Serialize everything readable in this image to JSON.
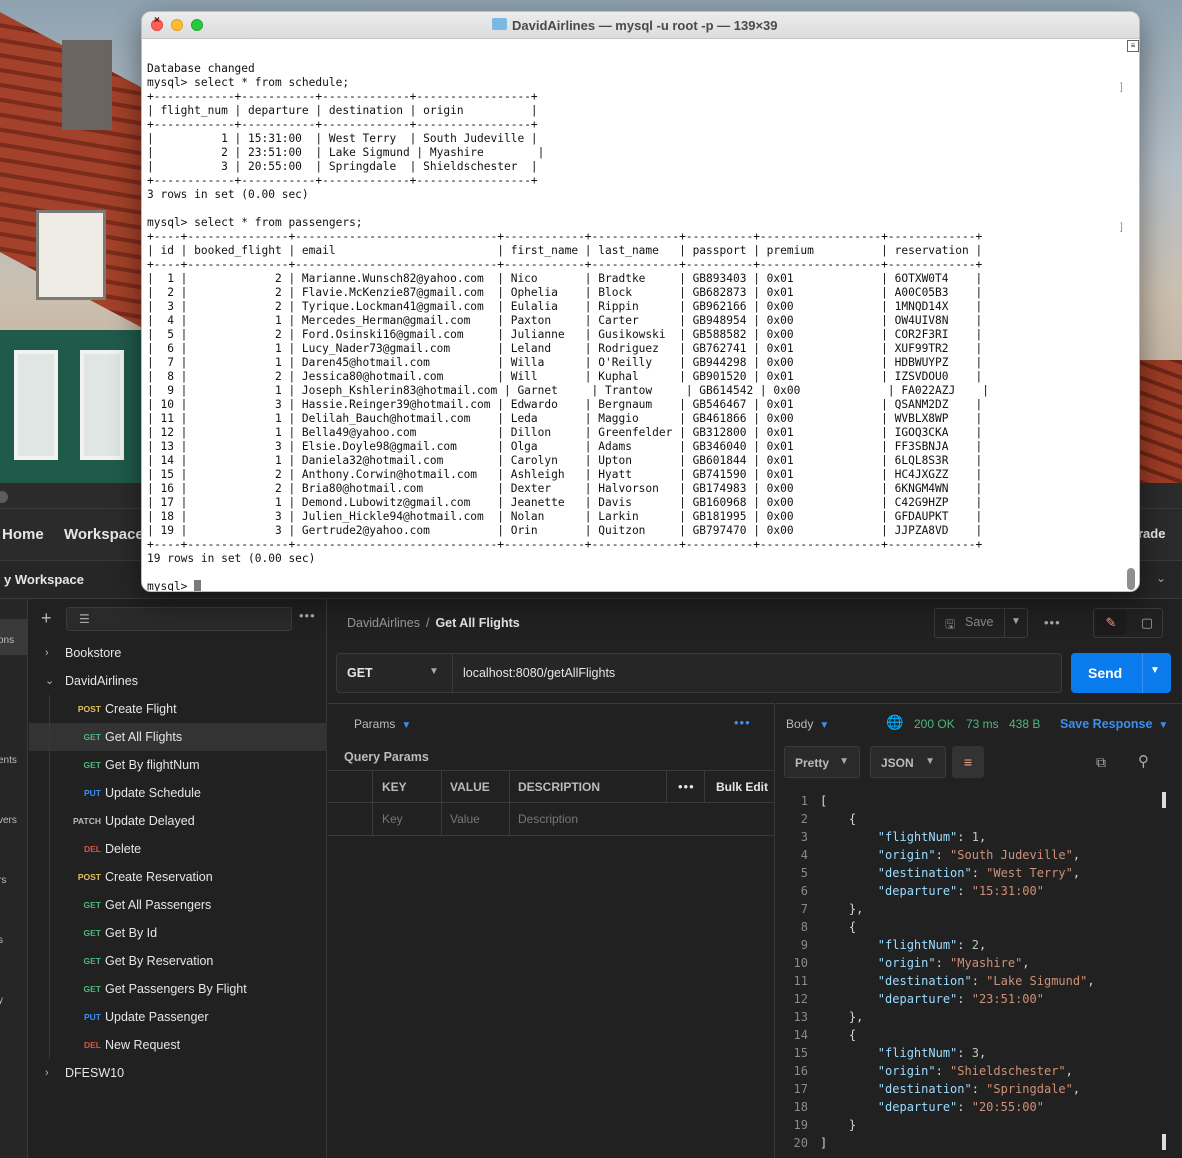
{
  "terminal": {
    "title": "DavidAirlines — mysql -u root -p — 139×39",
    "lines": [
      "Database changed",
      "mysql> select * from schedule;",
      "+------------+-----------+-------------+-----------------+",
      "| flight_num | departure | destination | origin          |",
      "+------------+-----------+-------------+-----------------+",
      "|          1 | 15:31:00  | West Terry  | South Judeville |",
      "|          2 | 23:51:00  | Lake Sigmund | Myashire        |",
      "|          3 | 20:55:00  | Springdale  | Shieldschester  |",
      "+------------+-----------+-------------+-----------------+",
      "3 rows in set (0.00 sec)",
      "",
      "mysql> select * from passengers;",
      "+----+---------------+------------------------------+------------+-------------+----------+------------------+-------------+",
      "| id | booked_flight | email                        | first_name | last_name   | passport | premium          | reservation |",
      "+----+---------------+------------------------------+------------+-------------+----------+------------------+-------------+",
      "|  1 |             2 | Marianne.Wunsch82@yahoo.com  | Nico       | Bradtke     | GB893403 | 0x01             | 6OTXW0T4    |",
      "|  2 |             2 | Flavie.McKenzie87@gmail.com  | Ophelia    | Block       | GB682873 | 0x01             | A00C05B3    |",
      "|  3 |             2 | Tyrique.Lockman41@gmail.com  | Eulalia    | Rippin      | GB962166 | 0x00             | 1MNQD14X    |",
      "|  4 |             1 | Mercedes_Herman@gmail.com    | Paxton     | Carter      | GB948954 | 0x00             | OW4UIV8N    |",
      "|  5 |             2 | Ford.Osinski16@gmail.com     | Julianne   | Gusikowski  | GB588582 | 0x00             | COR2F3RI    |",
      "|  6 |             1 | Lucy_Nader73@gmail.com       | Leland     | Rodriguez   | GB762741 | 0x01             | XUF99TR2    |",
      "|  7 |             1 | Daren45@hotmail.com          | Willa      | O'Reilly    | GB944298 | 0x00             | HDBWUYPZ    |",
      "|  8 |             2 | Jessica80@hotmail.com        | Will       | Kuphal      | GB901520 | 0x01             | IZSVDOU0    |",
      "|  9 |             1 | Joseph_Kshlerin83@hotmail.com | Garnet     | Trantow     | GB614542 | 0x00             | FA022AZJ    |",
      "| 10 |             3 | Hassie.Reinger39@hotmail.com | Edwardo    | Bergnaum    | GB546467 | 0x01             | QSANM2DZ    |",
      "| 11 |             1 | Delilah_Bauch@hotmail.com    | Leda       | Maggio      | GB461866 | 0x00             | WVBLX8WP    |",
      "| 12 |             1 | Bella49@yahoo.com            | Dillon     | Greenfelder | GB312800 | 0x01             | IGOQ3CKA    |",
      "| 13 |             3 | Elsie.Doyle98@gmail.com      | Olga       | Adams       | GB346040 | 0x01             | FF3SBNJA    |",
      "| 14 |             1 | Daniela32@hotmail.com        | Carolyn    | Upton       | GB601844 | 0x01             | 6LQL8S3R    |",
      "| 15 |             2 | Anthony.Corwin@hotmail.com   | Ashleigh   | Hyatt       | GB741590 | 0x01             | HC4JXGZZ    |",
      "| 16 |             2 | Bria80@hotmail.com           | Dexter     | Halvorson   | GB174983 | 0x00             | 6KNGM4WN    |",
      "| 17 |             1 | Demond.Lubowitz@gmail.com    | Jeanette   | Davis       | GB160968 | 0x00             | C42G9HZP    |",
      "| 18 |             3 | Julien_Hickle94@hotmail.com  | Nolan      | Larkin      | GB181995 | 0x00             | GFDAUPKT    |",
      "| 19 |             3 | Gertrude2@yahoo.com          | Orin       | Quitzon     | GB797470 | 0x00             | JJPZA8VD    |",
      "+----+---------------+------------------------------+------------+-------------+----------+------------------+-------------+",
      "19 rows in set (0.00 sec)",
      "",
      "mysql> "
    ]
  },
  "postman": {
    "nav": {
      "home": "Home",
      "workspaces": "Workspaces",
      "upgrade": "rade"
    },
    "workspace_name": "y Workspace",
    "rail": {
      "collections": "ons",
      "environments": "ents",
      "mock_servers": "vers",
      "monitors": "rs",
      "flows": "s",
      "history": "y"
    },
    "sidebar": {
      "collections": [
        {
          "name": "Bookstore",
          "expanded": false,
          "requests": []
        },
        {
          "name": "DavidAirlines",
          "expanded": true,
          "requests": [
            {
              "method": "POST",
              "name": "Create Flight",
              "active": false
            },
            {
              "method": "GET",
              "name": "Get All Flights",
              "active": true
            },
            {
              "method": "GET",
              "name": "Get By flightNum",
              "active": false
            },
            {
              "method": "PUT",
              "name": "Update Schedule",
              "active": false
            },
            {
              "method": "PATCH",
              "name": "Update Delayed",
              "active": false
            },
            {
              "method": "DEL",
              "name": "Delete",
              "active": false
            },
            {
              "method": "POST",
              "name": "Create Reservation",
              "active": false
            },
            {
              "method": "GET",
              "name": "Get All Passengers",
              "active": false
            },
            {
              "method": "GET",
              "name": "Get By Id",
              "active": false
            },
            {
              "method": "GET",
              "name": "Get By Reservation",
              "active": false
            },
            {
              "method": "GET",
              "name": "Get Passengers By Flight",
              "active": false
            },
            {
              "method": "PUT",
              "name": "Update Passenger",
              "active": false
            },
            {
              "method": "DEL",
              "name": "New Request",
              "active": false
            }
          ]
        },
        {
          "name": "DFESW10",
          "expanded": false,
          "requests": []
        }
      ]
    },
    "method_colors": {
      "GET": "#4cb87c",
      "POST": "#e5c05b",
      "PUT": "#3b8ff0",
      "PATCH": "#bbbbbb",
      "DEL": "#e05243"
    },
    "breadcrumb": {
      "collection": "DavidAirlines",
      "separator": "/",
      "request": "Get All Flights"
    },
    "save_label": "Save",
    "request": {
      "method": "GET",
      "url": "localhost:8080/getAllFlights",
      "send_label": "Send"
    },
    "params": {
      "tab_label": "Params",
      "title": "Query Params",
      "headers": [
        "KEY",
        "VALUE",
        "DESCRIPTION"
      ],
      "bulk_edit": "Bulk Edit",
      "placeholders": [
        "Key",
        "Value",
        "Description"
      ]
    },
    "response": {
      "tab_label": "Body",
      "status": "200 OK",
      "time": "73 ms",
      "size": "438 B",
      "save_label": "Save Response",
      "format": "Pretty",
      "language": "JSON",
      "body": [
        {
          "flightNum": 1,
          "origin": "South Judeville",
          "destination": "West Terry",
          "departure": "15:31:00"
        },
        {
          "flightNum": 2,
          "origin": "Myashire",
          "destination": "Lake Sigmund",
          "departure": "23:51:00"
        },
        {
          "flightNum": 3,
          "origin": "Shieldschester",
          "destination": "Springdale",
          "departure": "20:55:00"
        }
      ]
    }
  }
}
